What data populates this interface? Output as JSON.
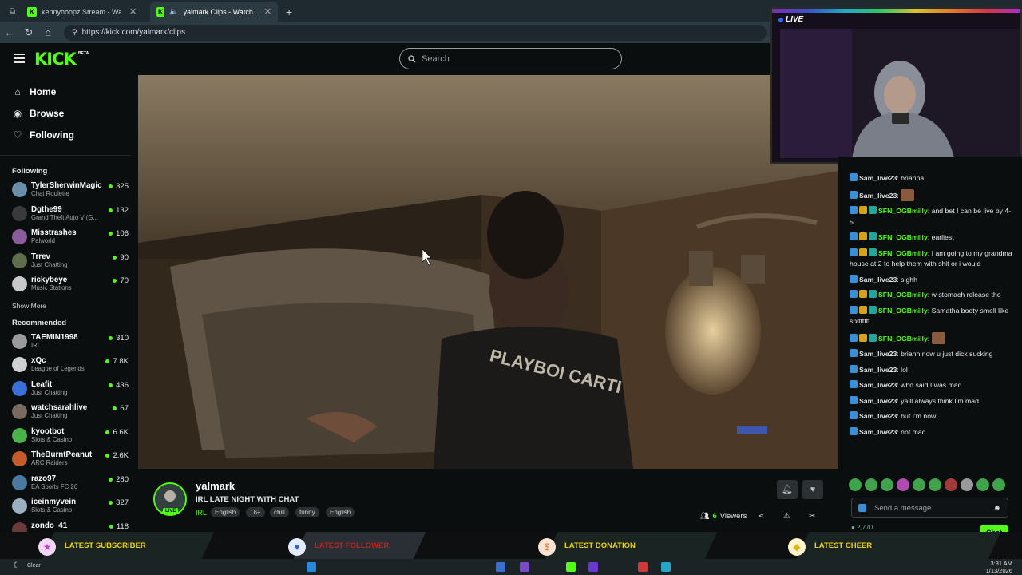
{
  "browser": {
    "tabs": [
      {
        "label": "kennyhoopz Stream - Watch L"
      },
      {
        "label": "yalmark Clips - Watch Live on"
      }
    ],
    "url": "https://kick.com/yalmark/clips"
  },
  "header": {
    "logo": "KICK",
    "logo_badge": "BETA",
    "search_placeholder": "Search"
  },
  "nav": {
    "items": [
      {
        "label": "Home",
        "icon": "home-icon"
      },
      {
        "label": "Browse",
        "icon": "compass-icon"
      },
      {
        "label": "Following",
        "icon": "heart-icon"
      }
    ]
  },
  "following": {
    "title": "Following",
    "channels": [
      {
        "name": "TylerSherwinMagic",
        "category": "Chat Roulette",
        "viewers": "325",
        "color": "#6b8fa8"
      },
      {
        "name": "Dgthe99",
        "category": "Grand Theft Auto V (G...",
        "viewers": "132",
        "color": "#3a3a3a"
      },
      {
        "name": "Misstrashes",
        "category": "Palworld",
        "viewers": "106",
        "color": "#8a5c9c"
      },
      {
        "name": "Trrev",
        "category": "Just Chatting",
        "viewers": "90",
        "color": "#5f6e4a"
      },
      {
        "name": "rickybeye",
        "category": "Music Stations",
        "viewers": "70",
        "color": "#c8c8c8"
      }
    ],
    "show_more": "Show More"
  },
  "recommended": {
    "title": "Recommended",
    "channels": [
      {
        "name": "TAEMIN1998",
        "category": "IRL",
        "viewers": "310",
        "color": "#9a9a9a"
      },
      {
        "name": "xQc",
        "category": "League of Legends",
        "viewers": "7.8K",
        "color": "#d0d0d0"
      },
      {
        "name": "Leafit",
        "category": "Just Chatting",
        "viewers": "436",
        "color": "#3b6fd8"
      },
      {
        "name": "watchsarahlive",
        "category": "Just Chatting",
        "viewers": "67",
        "color": "#7a6a60"
      },
      {
        "name": "kyootbot",
        "category": "Slots & Casino",
        "viewers": "6.6K",
        "color": "#49b349"
      },
      {
        "name": "TheBurntPeanut",
        "category": "ARC Raiders",
        "viewers": "2.6K",
        "color": "#c55a2a"
      },
      {
        "name": "razo97",
        "category": "EA Sports FC 26",
        "viewers": "280",
        "color": "#4a7aa0"
      },
      {
        "name": "iceinmyvein",
        "category": "Slots & Casino",
        "viewers": "327",
        "color": "#9ab0c0"
      },
      {
        "name": "zondo_41",
        "category": "",
        "viewers": "118",
        "color": "#6a3a3a"
      }
    ]
  },
  "stream": {
    "streamer": "yalmark",
    "live_tag": "LIVE",
    "title": "IRL LATE NIGHT WITH CHAT",
    "category": "IRL",
    "tags": [
      "English",
      "18+",
      "chill",
      "funny",
      "English"
    ],
    "viewers_count": "6",
    "viewers_label": "Viewers"
  },
  "chat": {
    "messages": [
      {
        "user": "Sam_live23",
        "text": "brianna",
        "green": false,
        "badges": [
          "blue"
        ]
      },
      {
        "user": "Sam_live23",
        "text": "",
        "green": false,
        "badges": [
          "blue"
        ],
        "emote": true
      },
      {
        "user": "SFN_OGBmilly",
        "text": "and bet I can be live by 4-5",
        "green": true,
        "badges": [
          "blue",
          "gold",
          "teal"
        ]
      },
      {
        "user": "SFN_OGBmilly",
        "text": "earliest",
        "green": true,
        "badges": [
          "blue",
          "gold",
          "teal"
        ]
      },
      {
        "user": "SFN_OGBmilly",
        "text": "I am going to my grandma house at 2 to help them with shit or i would",
        "green": true,
        "badges": [
          "blue",
          "gold",
          "teal"
        ]
      },
      {
        "user": "Sam_live23",
        "text": "sighh",
        "green": false,
        "badges": [
          "blue"
        ]
      },
      {
        "user": "SFN_OGBmilly",
        "text": "w stomach release tho",
        "green": true,
        "badges": [
          "blue",
          "gold",
          "teal"
        ]
      },
      {
        "user": "SFN_OGBmilly",
        "text": "Samatha booty smell like shitttttt",
        "green": true,
        "badges": [
          "blue",
          "gold",
          "teal"
        ]
      },
      {
        "user": "SFN_OGBmilly",
        "text": "",
        "green": true,
        "badges": [
          "blue",
          "gold",
          "teal"
        ],
        "emote": true
      },
      {
        "user": "Sam_live23",
        "text": "briann now u just dick sucking",
        "green": false,
        "badges": [
          "blue"
        ]
      },
      {
        "user": "Sam_live23",
        "text": "lol",
        "green": false,
        "badges": [
          "blue"
        ]
      },
      {
        "user": "Sam_live23",
        "text": "who said I was mad",
        "green": false,
        "badges": [
          "blue"
        ]
      },
      {
        "user": "Sam_live23",
        "text": "yalll always think I'm mad",
        "green": false,
        "badges": [
          "blue"
        ]
      },
      {
        "user": "Sam_live23",
        "text": "but I'm now",
        "green": false,
        "badges": [
          "blue"
        ]
      },
      {
        "user": "Sam_live23",
        "text": "not mad",
        "green": false,
        "badges": [
          "blue"
        ]
      }
    ],
    "input_placeholder": "Send a message",
    "points": "2,770",
    "send_label": "Chat"
  },
  "webcam": {
    "live_label": "LIVE"
  },
  "alerts": [
    {
      "label": "LATEST SUBSCRIBER",
      "icon": "star-icon"
    },
    {
      "label": "LATEST FOLLOWER",
      "icon": "heart-icon"
    },
    {
      "label": "LATEST DONATION",
      "icon": "dollar-icon"
    },
    {
      "label": "LATEST CHEER",
      "icon": "diamond-icon"
    }
  ],
  "taskbar": {
    "weather": "Clear",
    "time": "3:31 AM",
    "date": "1/13/2026"
  },
  "colors": {
    "kick_green": "#53fc18",
    "background": "#0b0e0f",
    "alert_yellow": "#ecd21a"
  }
}
